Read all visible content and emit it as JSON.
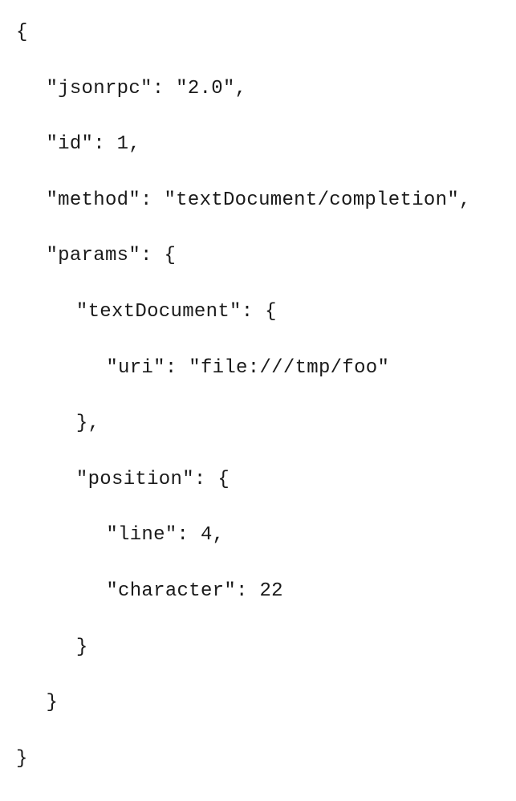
{
  "lines": {
    "l0": "{",
    "l1": "\"jsonrpc\": \"2.0\",",
    "l2": "\"id\": 1,",
    "l3": "\"method\": \"textDocument/completion\",",
    "l4": "\"params\": {",
    "l5": "\"textDocument\": {",
    "l6": "\"uri\": \"file:///tmp/foo\"",
    "l7": "},",
    "l8": "\"position\": {",
    "l9": "\"line\": 4,",
    "l10": "\"character\": 22",
    "l11": "}",
    "l12": "}",
    "l13": "}"
  }
}
